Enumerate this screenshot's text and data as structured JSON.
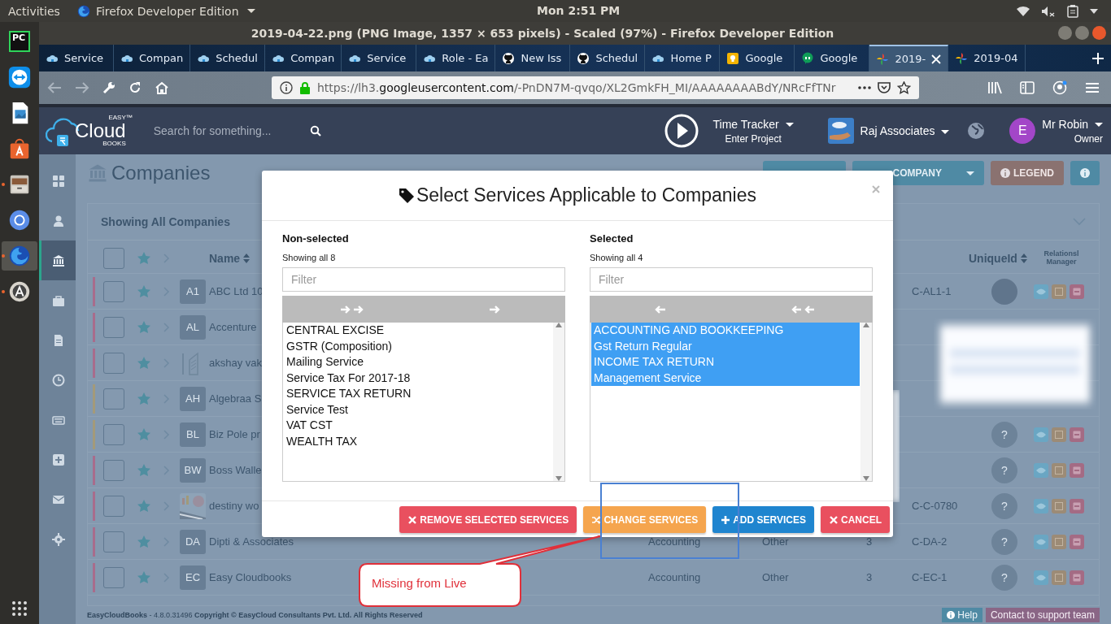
{
  "system_bar": {
    "activities": "Activities",
    "app_menu": "Firefox Developer Edition",
    "clock": "Mon  2:51 PM"
  },
  "dock": {
    "items": [
      {
        "kind": "pycharm",
        "label": "PC",
        "running": false,
        "selected": false
      },
      {
        "kind": "remote",
        "running": false,
        "selected": false
      },
      {
        "kind": "document",
        "running": false,
        "selected": false
      },
      {
        "kind": "store",
        "running": false,
        "selected": false
      },
      {
        "kind": "files",
        "running": true,
        "selected": false
      },
      {
        "kind": "chromium",
        "running": false,
        "selected": false
      },
      {
        "kind": "firefox",
        "running": true,
        "selected": true
      },
      {
        "kind": "updater",
        "running": true,
        "selected": false
      }
    ]
  },
  "window": {
    "title": "2019-04-22.png (PNG Image, 1357 × 653 pixels) - Scaled (97%) - Firefox Developer Edition"
  },
  "tabs": [
    {
      "label": "Service",
      "kind": "cloud",
      "selected": false
    },
    {
      "label": "Compan",
      "kind": "cloud",
      "selected": false
    },
    {
      "label": "Schedul",
      "kind": "cloud",
      "selected": false
    },
    {
      "label": "Compan",
      "kind": "cloud",
      "selected": false
    },
    {
      "label": "Service",
      "kind": "cloud",
      "selected": false
    },
    {
      "label": "Role - Ea",
      "kind": "cloud",
      "selected": false
    },
    {
      "label": "New Iss",
      "kind": "github",
      "selected": false
    },
    {
      "label": "Schedul",
      "kind": "github",
      "selected": false
    },
    {
      "label": "Home P",
      "kind": "cloud",
      "selected": false
    },
    {
      "label": "Google",
      "kind": "bulb",
      "selected": false
    },
    {
      "label": "Google",
      "kind": "chat",
      "selected": false
    },
    {
      "label": "2019-",
      "kind": "pinwheel",
      "selected": true
    },
    {
      "label": "2019-04",
      "kind": "pinwheel",
      "selected": false
    }
  ],
  "url": {
    "scheme": "https://lh3.",
    "domain": "googleusercontent.com",
    "path": "/-PnDN7M-qvqo/XL2GmkFH_MI/AAAAAAAABdY/NRcFfTNr"
  },
  "app_header": {
    "logo": {
      "top": "EASY",
      "main": "Cloud",
      "bottom": "BOOKS",
      "mark": "™"
    },
    "search": {
      "placeholder": "Search for something..."
    },
    "tracker": {
      "title": "Time Tracker",
      "subtitle": "Enter Project"
    },
    "organization": "Raj Associates",
    "user": {
      "initial": "E",
      "name": "Mr Robin",
      "role": "Owner"
    }
  },
  "sidebar": {
    "items": [
      {
        "kind": "dashboard",
        "selected": false
      },
      {
        "kind": "user",
        "selected": false
      },
      {
        "kind": "bank",
        "selected": true
      },
      {
        "kind": "briefcase",
        "selected": false
      },
      {
        "kind": "document",
        "selected": false
      },
      {
        "kind": "clock",
        "selected": false
      },
      {
        "kind": "keyboard",
        "selected": false
      },
      {
        "kind": "plus",
        "selected": false
      },
      {
        "kind": "mail",
        "selected": false
      },
      {
        "kind": "gear",
        "selected": false
      }
    ]
  },
  "page": {
    "title": "Companies",
    "buttons": [
      {
        "kind": "create"
      },
      {
        "label": "COMPANY",
        "kind": "import"
      },
      {
        "label": "LEGEND",
        "kind": "legend"
      },
      {
        "kind": "info"
      }
    ]
  },
  "panel": {
    "heading": "Showing All Companies",
    "all_checked": false,
    "columns": {
      "name": "Name",
      "unique_id": "UniqueId",
      "manager": "Relationsl Manager"
    }
  },
  "rows": [
    {
      "initials": "A1",
      "name": "ABC Ltd 10",
      "color": "#a86c8c",
      "kind": "initials",
      "checked": false,
      "unique_id": "C-AL1-1",
      "actions": true
    },
    {
      "initials": "AL",
      "name": "Accenture",
      "color": "#a86c8c",
      "kind": "initials",
      "checked": false,
      "actions": false
    },
    {
      "name": "akshay vak",
      "color": "#a86c8c",
      "checked": false,
      "actions": false
    },
    {
      "initials": "AH",
      "name": "Algebraa S",
      "color": "#a39a7a",
      "kind": "initials",
      "checked": false,
      "actions": false
    },
    {
      "initials": "BL",
      "name": "Biz Pole pr",
      "color": "#a39a7a",
      "kind": "initials",
      "checked": false,
      "manager": {
        "kind": "unknown",
        "text": "?"
      },
      "actions": true
    },
    {
      "initials": "BW",
      "name": "Boss Walle",
      "color": "#a86c8c",
      "kind": "initials",
      "checked": false,
      "manager": {
        "kind": "unknown",
        "text": "?"
      },
      "actions": true
    },
    {
      "name": "destiny wo",
      "color": "#a86c8c",
      "kind": "chart",
      "checked": false,
      "unique_id": "C-C-0780",
      "manager": {
        "kind": "unknown",
        "text": "?"
      },
      "actions": true
    },
    {
      "initials": "DA",
      "name": "Dipti & Associates",
      "color": "#a86c8c",
      "kind": "initials",
      "checked": false,
      "type": "Accounting",
      "category": "Other",
      "count": "3",
      "unique_id": "C-DA-2",
      "manager": {
        "kind": "unknown",
        "text": "?"
      },
      "actions": true
    },
    {
      "initials": "EC",
      "name": "Easy Cloudbooks",
      "color": "#a86c8c",
      "kind": "initials",
      "checked": false,
      "type": "Accounting",
      "category": "Other",
      "count": "3",
      "unique_id": "C-EC-1",
      "manager": {
        "kind": "unknown",
        "text": "?"
      },
      "actions": true
    }
  ],
  "footer": {
    "brand": "EasyCloudBooks",
    "version": "- 4.8.0.31496",
    "copyright": "Copyright © EasyCloud Consultants Pvt. Ltd. All Rights Reserved",
    "help": "Help",
    "support": "Contact to support team"
  },
  "modal": {
    "title": "Select Services Applicable to Companies",
    "lists": [
      {
        "heading": "Non-selected",
        "count": "Showing all 8",
        "filter_placeholder": "Filter",
        "move": [
          {
            "kind": "all"
          },
          {
            "kind": "one"
          }
        ],
        "items": [
          {
            "label": "CENTRAL EXCISE",
            "selected": false
          },
          {
            "label": "GSTR (Composition)",
            "selected": false
          },
          {
            "label": "Mailing Service",
            "selected": false
          },
          {
            "label": "Service Tax For 2017-18",
            "selected": false
          },
          {
            "label": "SERVICE TAX RETURN",
            "selected": false
          },
          {
            "label": "Service Test",
            "selected": false
          },
          {
            "label": "VAT CST",
            "selected": false
          },
          {
            "label": "WEALTH TAX",
            "selected": false
          }
        ]
      },
      {
        "heading": "Selected",
        "count": "Showing all 4",
        "filter_placeholder": "Filter",
        "move": [
          {
            "kind": "one"
          },
          {
            "kind": "all"
          }
        ],
        "items": [
          {
            "label": "ACCOUNTING AND BOOKKEEPING",
            "selected": true
          },
          {
            "label": "Gst Return Regular",
            "selected": true
          },
          {
            "label": "INCOME TAX RETURN",
            "selected": true
          },
          {
            "label": "Management Service",
            "selected": true
          }
        ]
      }
    ],
    "buttons": [
      {
        "label": "REMOVE SELECTED SERVICES",
        "kind": "remove"
      },
      {
        "label": "CHANGE SERVICES",
        "kind": "change"
      },
      {
        "label": "ADD SERVICES",
        "kind": "add"
      },
      {
        "label": "CANCEL",
        "kind": "cancel"
      }
    ]
  },
  "annotation": {
    "text": "Missing from Live"
  }
}
